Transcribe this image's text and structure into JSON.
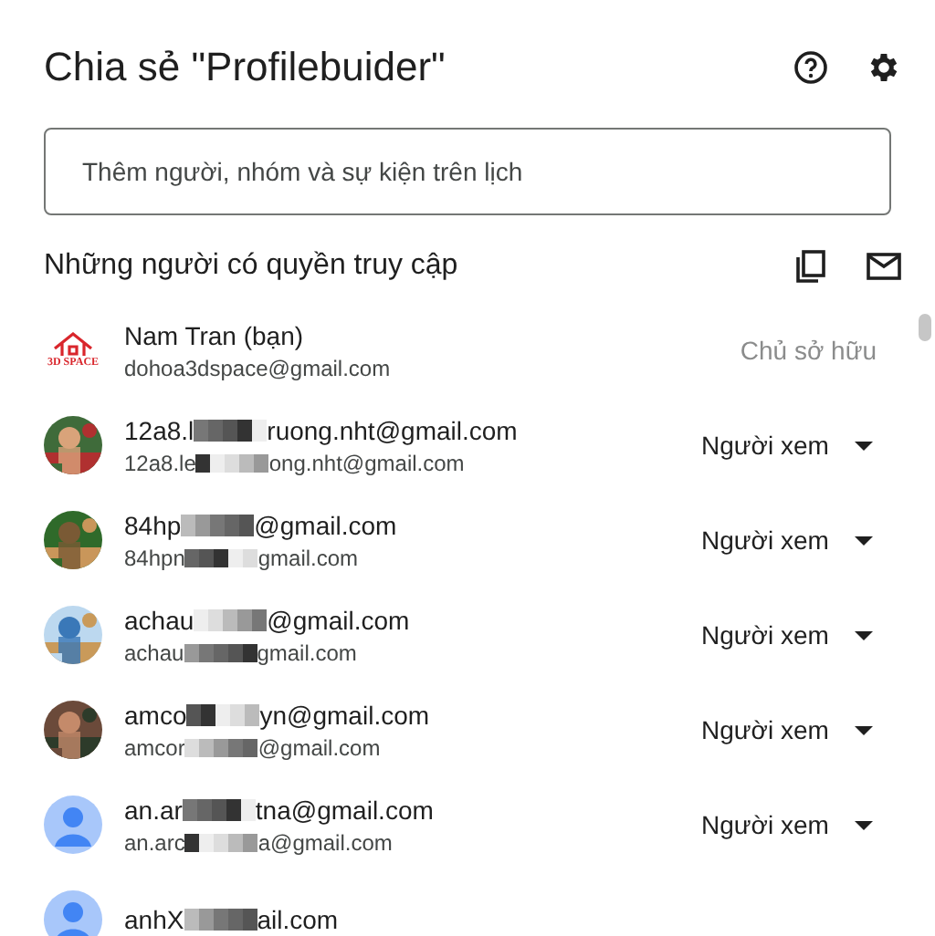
{
  "dialog": {
    "title": "Chia sẻ \"Profilebuider\""
  },
  "add_field": {
    "placeholder": "Thêm người, nhóm và sự kiện trên lịch"
  },
  "access_header": "Những người có quyền truy cập",
  "people": [
    {
      "avatar": {
        "kind": "logo",
        "text": "3D SPACE"
      },
      "name": [
        "Nam Tran (bạn)"
      ],
      "email": [
        "dohoa3dspace@gmail.com"
      ],
      "role": "Chủ sở hữu",
      "editable": false
    },
    {
      "name": [
        "12a8.l",
        "ruong.nht@gmail.com"
      ],
      "email": [
        "12a8.le",
        "ong.nht@gmail.com"
      ],
      "role": "Người xem",
      "editable": true
    },
    {
      "name": [
        "84hp",
        "@gmail.com"
      ],
      "email": [
        "84hpn",
        "gmail.com"
      ],
      "role": "Người xem",
      "editable": true
    },
    {
      "name": [
        "achau",
        "@gmail.com"
      ],
      "email": [
        "achau",
        "gmail.com"
      ],
      "role": "Người xem",
      "editable": true
    },
    {
      "name": [
        "amco",
        "yn@gmail.com"
      ],
      "email": [
        "amcor",
        "@gmail.com"
      ],
      "role": "Người xem",
      "editable": true
    },
    {
      "avatar": {
        "kind": "default"
      },
      "name": [
        "an.ar",
        "tna@gmail.com"
      ],
      "email": [
        "an.arc",
        "a@gmail.com"
      ],
      "role": "Người xem",
      "editable": true
    },
    {
      "avatar": {
        "kind": "default"
      },
      "name": [
        "anhX",
        "ail.com"
      ]
    }
  ]
}
